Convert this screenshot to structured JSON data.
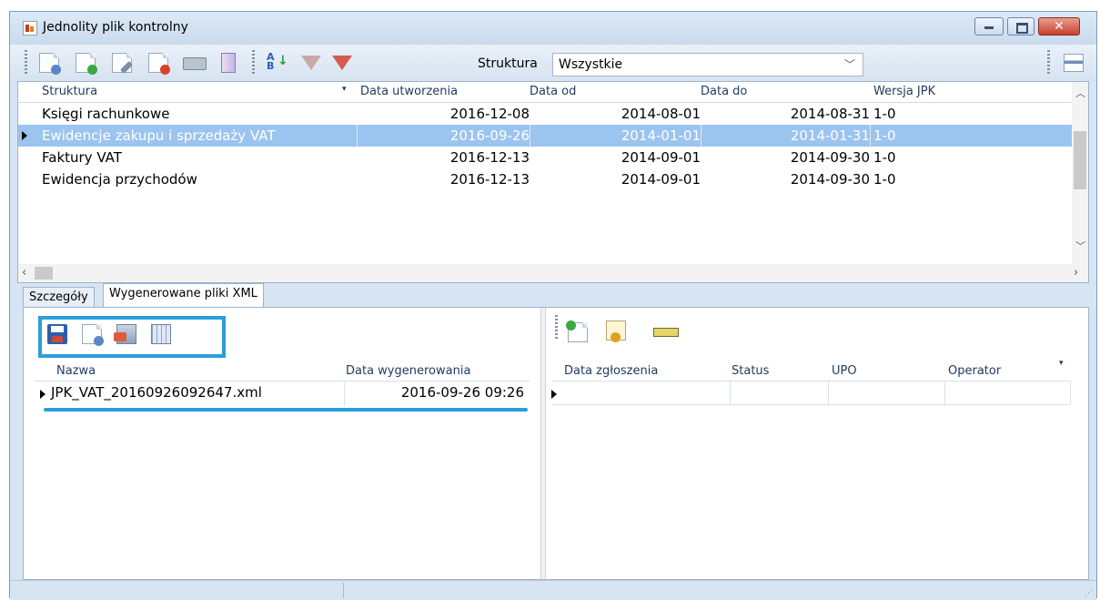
{
  "window": {
    "title": "Jednolity plik kontrolny",
    "minimize": "",
    "maximize": "",
    "close": "✕"
  },
  "toolbar": {
    "icons": [
      "preview-doc-icon",
      "add-doc-icon",
      "edit-doc-icon",
      "delete-doc-icon",
      "print-icon",
      "report-icon",
      "sort-az-icon",
      "filter-icon",
      "clear-filter-icon",
      "layout-icon"
    ],
    "struktura_label": "Struktura",
    "struktura_value": "Wszystkie"
  },
  "grid": {
    "columns": [
      "Struktura",
      "Data utworzenia",
      "Data od",
      "Data do",
      "Wersja JPK"
    ],
    "rows": [
      {
        "struktura": "Księgi rachunkowe",
        "utworzenia": "2016-12-08",
        "od": "2014-08-01",
        "do": "2014-08-31",
        "wersja": "1-0"
      },
      {
        "struktura": "Ewidencje zakupu i sprzedaży VAT",
        "utworzenia": "2016-09-26",
        "od": "2014-01-01",
        "do": "2014-01-31",
        "wersja": "1-0"
      },
      {
        "struktura": "Faktury VAT",
        "utworzenia": "2016-12-13",
        "od": "2014-09-01",
        "do": "2014-09-30",
        "wersja": "1-0"
      },
      {
        "struktura": "Ewidencja przychodów",
        "utworzenia": "2016-12-13",
        "od": "2014-09-01",
        "do": "2014-09-30",
        "wersja": "1-0"
      }
    ],
    "selected_row": 1
  },
  "tabs": [
    "Szczegóły",
    "Wygenerowane pliki XML"
  ],
  "active_tab": "Wygenerowane pliki XML",
  "files": {
    "columns": [
      "Nazwa",
      "Data wygenerowania"
    ],
    "rows": [
      {
        "nazwa": "JPK_VAT_20160926092647.xml",
        "data": "2016-09-26 09:26"
      }
    ]
  },
  "submissions": {
    "columns": [
      "Data zgłoszenia",
      "Status",
      "UPO",
      "Operator"
    ]
  },
  "colors": {
    "accent": "#2a9fd8",
    "selection": "#9bc4ee",
    "chrome": "#d7e4f2"
  }
}
